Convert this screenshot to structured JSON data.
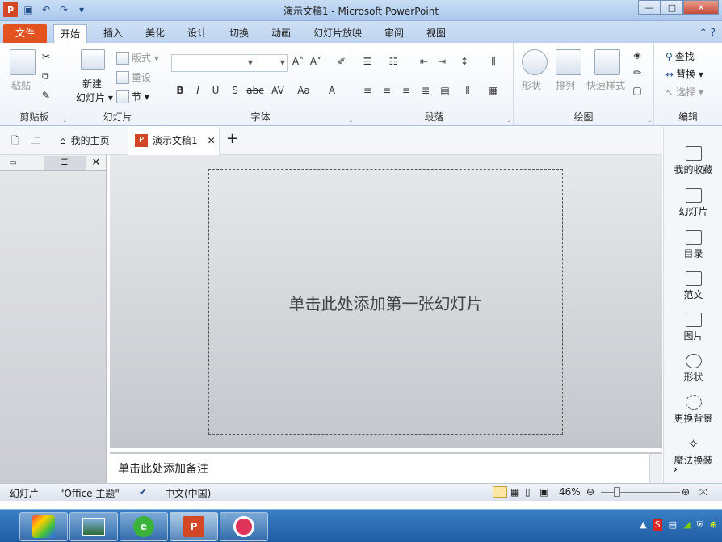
{
  "window": {
    "title": "演示文稿1 - Microsoft PowerPoint"
  },
  "ribbon_tabs": [
    "文件",
    "开始",
    "插入",
    "美化",
    "设计",
    "切换",
    "动画",
    "幻灯片放映",
    "审阅",
    "视图"
  ],
  "ribbon": {
    "clipboard": {
      "label": "剪贴板",
      "paste": "粘贴"
    },
    "slides": {
      "label": "幻灯片",
      "new_slide_line1": "新建",
      "new_slide_line2": "幻灯片",
      "layout": "版式",
      "reset": "重设",
      "section": "节"
    },
    "font": {
      "label": "字体"
    },
    "paragraph": {
      "label": "段落"
    },
    "drawing": {
      "label": "绘图",
      "shape": "形状",
      "arrange": "排列",
      "quick_style": "快速样式"
    },
    "editing": {
      "label": "编辑",
      "find": "查找",
      "replace": "替换",
      "select": "选择"
    }
  },
  "doc_tabs": {
    "home": "我的主页",
    "doc": "演示文稿1"
  },
  "slide": {
    "placeholder": "单击此处添加第一张幻灯片"
  },
  "notes": {
    "placeholder": "单击此处添加备注"
  },
  "sidebar": [
    "我的收藏",
    "幻灯片",
    "目录",
    "范文",
    "图片",
    "形状",
    "更换背景",
    "魔法换装"
  ],
  "status": {
    "slide": "幻灯片",
    "theme": "\"Office 主题\"",
    "language": "中文(中国)",
    "zoom": "46%"
  },
  "colors": {
    "file_tab": "#e2531f",
    "accent": "#1f5da3"
  }
}
